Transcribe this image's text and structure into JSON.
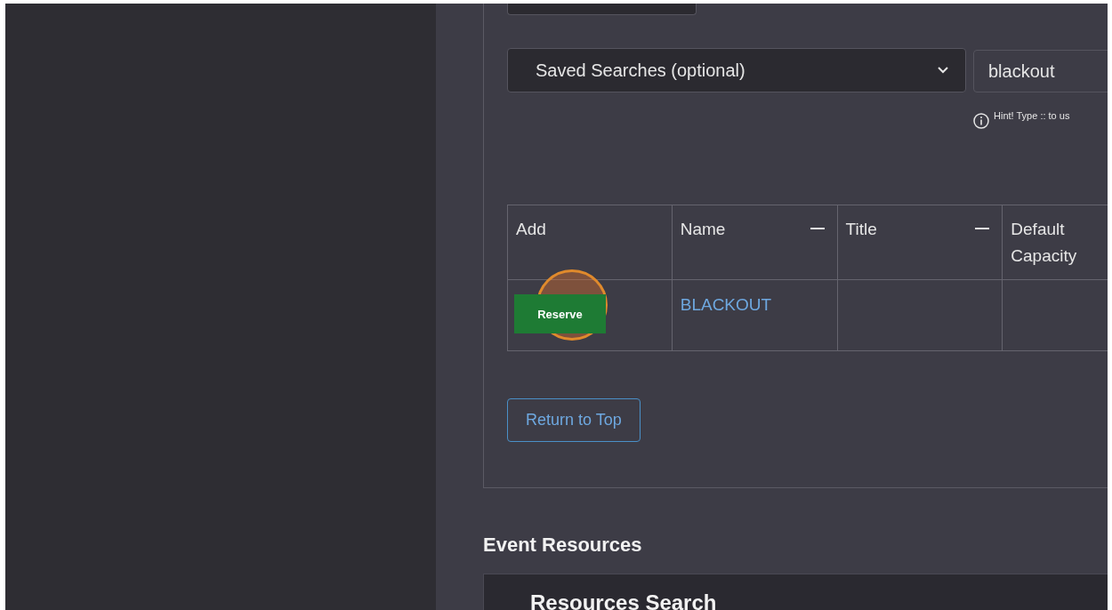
{
  "saved_searches": {
    "placeholder": "Saved Searches (optional)"
  },
  "search_field": {
    "value": "blackout"
  },
  "hint": "Hint! Type :: to us",
  "table": {
    "columns": [
      {
        "label": "Add",
        "collapsible": false
      },
      {
        "label": "Name",
        "collapsible": true
      },
      {
        "label": "Title",
        "collapsible": true
      },
      {
        "label": "Default Capacity",
        "collapsible": false
      }
    ],
    "rows": [
      {
        "action": "Reserve",
        "name": "BLACKOUT",
        "title": "",
        "capacity": ""
      }
    ]
  },
  "return_button": "Return to Top",
  "section_title": "Event Resources",
  "search_panel_title": "Resources Search"
}
